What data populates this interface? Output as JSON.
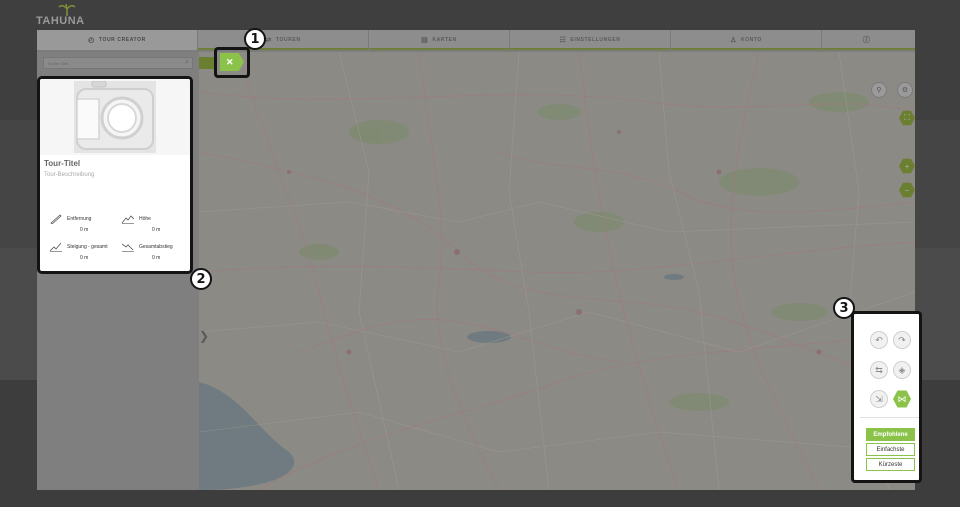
{
  "brand": {
    "logo_text": "TAHUNA"
  },
  "nav": {
    "tabs": [
      {
        "label": "TOUR CREATOR",
        "icon": "compass-icon"
      },
      {
        "label": "TOUREN",
        "icon": "route-icon"
      },
      {
        "label": "KARTEN",
        "icon": "map-icon"
      },
      {
        "label": "EINSTELLUNGEN",
        "icon": "settings-icon"
      },
      {
        "label": "KONTO",
        "icon": "user-icon"
      },
      {
        "label": "",
        "icon": "info-icon"
      }
    ]
  },
  "sidebar": {
    "search_placeholder": "Suche Orte"
  },
  "map": {
    "close_icon": "close-icon"
  },
  "tour_card": {
    "title": "Tour-Titel",
    "description": "Tour-Beschreibung",
    "stats": [
      {
        "label": "Entfernung",
        "value": "0 m",
        "icon": "ruler-icon"
      },
      {
        "label": "Höhe",
        "value": "0 m",
        "icon": "elevation-icon"
      },
      {
        "label": "Steigung - gesamt",
        "value": "0 m",
        "icon": "ascent-icon"
      },
      {
        "label": "Gesamtabstieg",
        "value": "0 m",
        "icon": "descent-icon"
      }
    ]
  },
  "routing_panel": {
    "tools": [
      "undo-icon",
      "redo-icon",
      "reverse-route-icon",
      "eraser-icon",
      "import-icon",
      "snap-to-road-icon"
    ],
    "options": [
      "Empfohlene",
      "Einfachste",
      "Kürzeste"
    ],
    "selected": "Empfohlene"
  },
  "callouts": [
    "1",
    "2",
    "3"
  ],
  "colors": {
    "accent": "#8bc34a",
    "overlay": "#3f3f3f",
    "outline": "#141414"
  }
}
